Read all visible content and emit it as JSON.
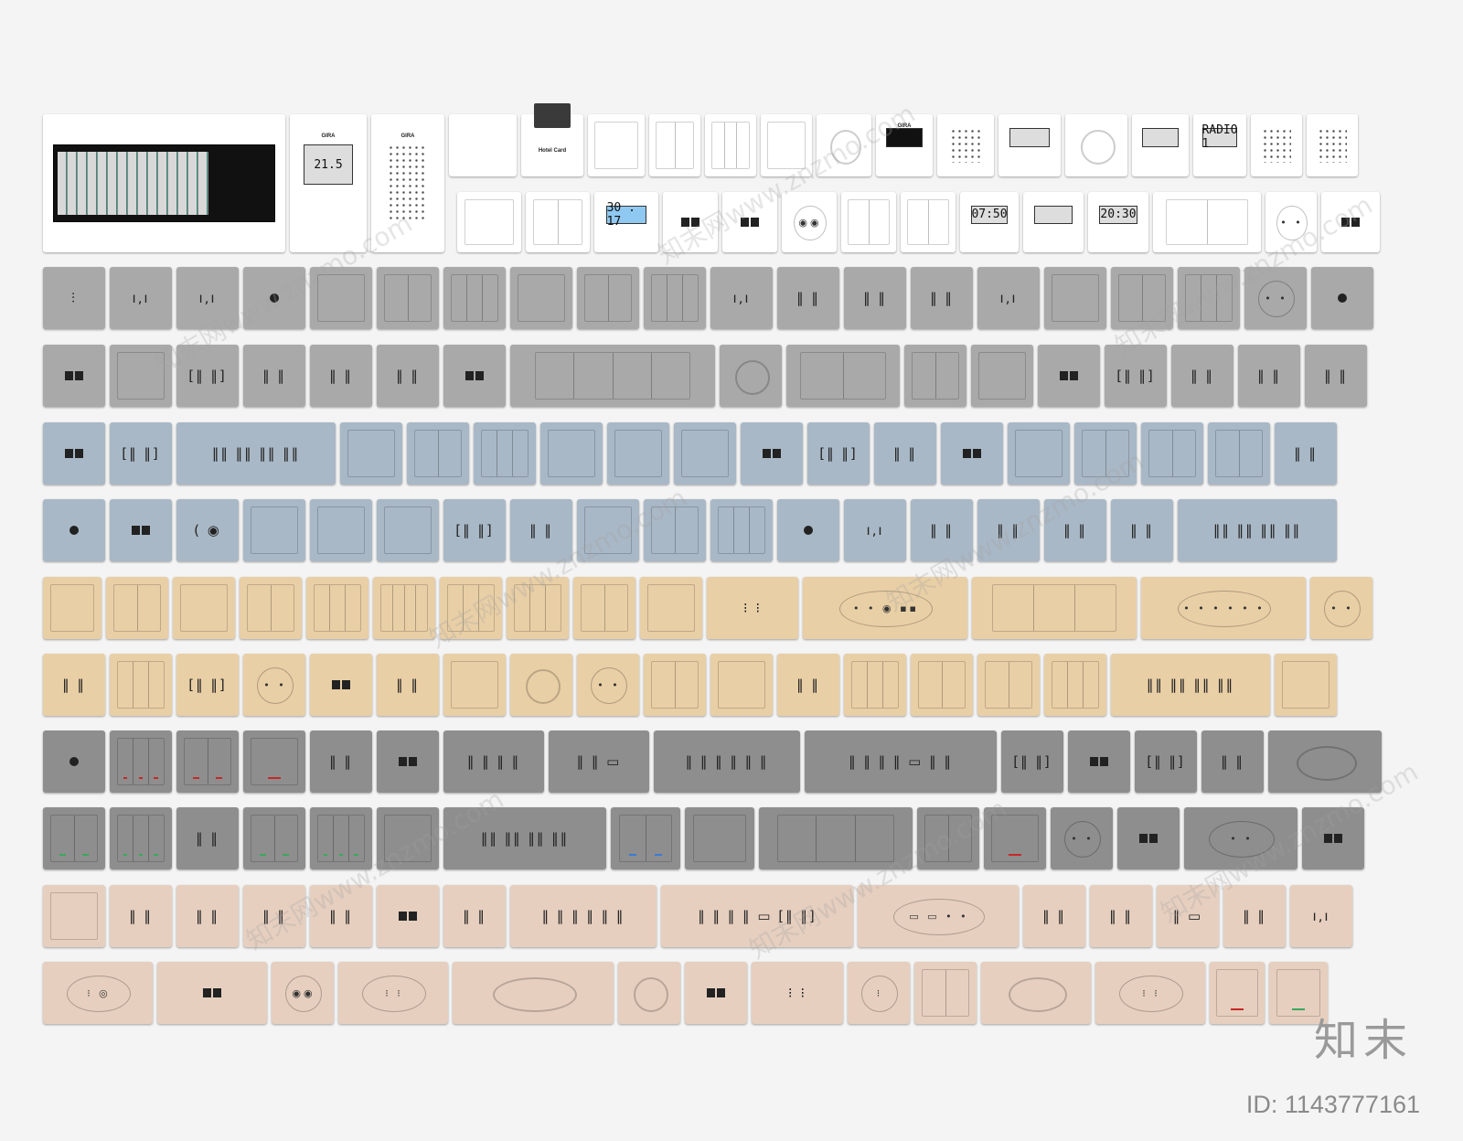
{
  "colors": {
    "white": "#ffffff",
    "gray": "#a9a9a9",
    "blue": "#a9b8c6",
    "beige": "#e9cfa6",
    "dark": "#8e8e8e",
    "pink": "#e6cfbf",
    "led_red": "#c62828",
    "led_green": "#3aa85c",
    "led_blue": "#3a7bd5"
  },
  "top_row1": [
    {
      "kind": "breaker",
      "w": 265
    },
    {
      "kind": "lcd",
      "w": 84,
      "brand": "GIRA",
      "lcd": "21.5"
    },
    {
      "kind": "grid",
      "w": 80,
      "brand": "GIRA"
    },
    {
      "kind": "sock",
      "w": 74
    },
    {
      "kind": "card",
      "w": 68,
      "card_text": "Hotel Card"
    },
    {
      "kind": "rocker",
      "n": 1,
      "w": 62
    },
    {
      "kind": "rocker",
      "n": 2,
      "w": 56
    },
    {
      "kind": "rocker",
      "n": 3,
      "w": 56
    },
    {
      "kind": "rocker",
      "n": 1,
      "w": 56
    },
    {
      "kind": "knob",
      "w": 60
    },
    {
      "kind": "lcd",
      "w": 62,
      "lcd_class": "dark",
      "brand": "GIRA"
    },
    {
      "kind": "grid",
      "w": 62
    },
    {
      "kind": "lcd",
      "w": 68
    },
    {
      "kind": "knob",
      "w": 68
    },
    {
      "kind": "lcd",
      "w": 62
    },
    {
      "kind": "lcd",
      "w": 58,
      "lcd": "RADIO 1"
    },
    {
      "kind": "grid",
      "w": 56
    },
    {
      "kind": "grid",
      "w": 56
    }
  ],
  "top_row2": [
    {
      "kind": "rocker",
      "n": 1,
      "w": 70
    },
    {
      "kind": "rocker",
      "n": 2,
      "w": 70
    },
    {
      "kind": "lcd",
      "w": 70,
      "lcd": "30 . 17",
      "lcd_class": "blue"
    },
    {
      "kind": "port",
      "w": 60
    },
    {
      "kind": "port",
      "w": 60
    },
    {
      "kind": "round",
      "w": 60,
      "sock": "◉◉"
    },
    {
      "kind": "rocker",
      "n": 2,
      "w": 60
    },
    {
      "kind": "rocker",
      "n": 2,
      "w": 60
    },
    {
      "kind": "lcd",
      "w": 64,
      "lcd": "07:50"
    },
    {
      "kind": "lcd",
      "w": 66
    },
    {
      "kind": "lcd",
      "w": 66,
      "lcd": "20:30"
    },
    {
      "kind": "rocker",
      "n": 2,
      "w": 118
    },
    {
      "kind": "round",
      "w": 56,
      "sock": "• •"
    },
    {
      "kind": "port",
      "w": 64
    }
  ],
  "grid_rows": [
    {
      "color": "gray",
      "plates": [
        {
          "kind": "sock",
          "w": 68,
          "sock": "⫶"
        },
        {
          "kind": "sock",
          "w": 68,
          "sock": "ı‚ı"
        },
        {
          "kind": "sock",
          "w": 68,
          "sock": "ı‚ı"
        },
        {
          "kind": "dot",
          "w": 68
        },
        {
          "kind": "rocker",
          "n": 1,
          "w": 68
        },
        {
          "kind": "rocker",
          "n": 2,
          "w": 68
        },
        {
          "kind": "rocker",
          "n": 3,
          "w": 68
        },
        {
          "kind": "rocker",
          "n": 1,
          "w": 68
        },
        {
          "kind": "rocker",
          "n": 2,
          "w": 68
        },
        {
          "kind": "rocker",
          "n": 3,
          "w": 68
        },
        {
          "kind": "sock",
          "w": 68,
          "sock": "ı‚ı"
        },
        {
          "kind": "sock",
          "w": 68,
          "sock": "‖ ‖"
        },
        {
          "kind": "sock",
          "w": 68,
          "sock": "‖ ‖"
        },
        {
          "kind": "sock",
          "w": 68,
          "sock": "‖ ‖"
        },
        {
          "kind": "sock",
          "w": 68,
          "sock": "ı‚ı"
        },
        {
          "kind": "rocker",
          "n": 1,
          "w": 68
        },
        {
          "kind": "rocker",
          "n": 2,
          "w": 68
        },
        {
          "kind": "rocker",
          "n": 3,
          "w": 68
        },
        {
          "kind": "round",
          "w": 68,
          "sock": "• •"
        },
        {
          "kind": "dot",
          "w": 68
        }
      ]
    },
    {
      "color": "gray",
      "plates": [
        {
          "kind": "port",
          "w": 68
        },
        {
          "kind": "rocker",
          "n": 1,
          "w": 68
        },
        {
          "kind": "sock",
          "w": 68,
          "sock": "[‖ ‖]"
        },
        {
          "kind": "sock",
          "w": 68,
          "sock": "‖ ‖"
        },
        {
          "kind": "sock",
          "w": 68,
          "sock": "‖ ‖"
        },
        {
          "kind": "sock",
          "w": 68,
          "sock": "‖ ‖"
        },
        {
          "kind": "port",
          "w": 68
        },
        {
          "kind": "rocker",
          "n": 4,
          "w": 224
        },
        {
          "kind": "knob",
          "w": 68
        },
        {
          "kind": "rocker",
          "n": 2,
          "w": 124
        },
        {
          "kind": "rocker",
          "n": 2,
          "w": 68
        },
        {
          "kind": "rocker",
          "n": 1,
          "w": 68
        },
        {
          "kind": "port",
          "w": 68
        },
        {
          "kind": "sock",
          "w": 68,
          "sock": "[‖ ‖]"
        },
        {
          "kind": "sock",
          "w": 68,
          "sock": "‖ ‖"
        },
        {
          "kind": "sock",
          "w": 68,
          "sock": "‖ ‖"
        },
        {
          "kind": "sock",
          "w": 68,
          "sock": "‖ ‖"
        }
      ]
    },
    {
      "color": "blue",
      "plates": [
        {
          "kind": "port",
          "w": 68
        },
        {
          "kind": "sock",
          "w": 68,
          "sock": "[‖ ‖]"
        },
        {
          "kind": "sock",
          "w": 174,
          "sock": "‖‖ ‖‖ ‖‖ ‖‖"
        },
        {
          "kind": "rocker",
          "n": 1,
          "w": 68
        },
        {
          "kind": "rocker",
          "n": 2,
          "w": 68
        },
        {
          "kind": "rocker",
          "n": 3,
          "w": 68
        },
        {
          "kind": "rocker",
          "n": 1,
          "w": 68
        },
        {
          "kind": "rocker",
          "n": 1,
          "w": 68
        },
        {
          "kind": "rocker",
          "n": 1,
          "w": 68
        },
        {
          "kind": "port",
          "w": 68
        },
        {
          "kind": "sock",
          "w": 68,
          "sock": "[‖ ‖]"
        },
        {
          "kind": "sock",
          "w": 68,
          "sock": "‖ ‖"
        },
        {
          "kind": "port",
          "w": 68
        },
        {
          "kind": "rocker",
          "n": 1,
          "w": 68
        },
        {
          "kind": "rocker",
          "n": 2,
          "w": 68
        },
        {
          "kind": "rocker",
          "n": 2,
          "w": 68
        },
        {
          "kind": "rocker",
          "n": 2,
          "w": 68
        },
        {
          "kind": "sock",
          "w": 68,
          "sock": "‖ ‖"
        }
      ]
    },
    {
      "color": "blue",
      "plates": [
        {
          "kind": "dot",
          "w": 68
        },
        {
          "kind": "port",
          "w": 68
        },
        {
          "kind": "sock",
          "w": 68,
          "sock": "( ◉"
        },
        {
          "kind": "rocker",
          "n": 1,
          "w": 68
        },
        {
          "kind": "rocker",
          "n": 1,
          "w": 68
        },
        {
          "kind": "rocker",
          "n": 1,
          "w": 68
        },
        {
          "kind": "sock",
          "w": 68,
          "sock": "[‖ ‖]"
        },
        {
          "kind": "sock",
          "w": 68,
          "sock": "‖ ‖"
        },
        {
          "kind": "rocker",
          "n": 1,
          "w": 68
        },
        {
          "kind": "rocker",
          "n": 2,
          "w": 68
        },
        {
          "kind": "rocker",
          "n": 3,
          "w": 68
        },
        {
          "kind": "dot",
          "w": 68
        },
        {
          "kind": "sock",
          "w": 68,
          "sock": "ı‚ı"
        },
        {
          "kind": "sock",
          "w": 68,
          "sock": "‖ ‖"
        },
        {
          "kind": "sock",
          "w": 68,
          "sock": "‖ ‖"
        },
        {
          "kind": "sock",
          "w": 68,
          "sock": "‖ ‖"
        },
        {
          "kind": "sock",
          "w": 68,
          "sock": "‖ ‖"
        },
        {
          "kind": "sock",
          "w": 174,
          "sock": "‖‖ ‖‖ ‖‖ ‖‖"
        }
      ]
    },
    {
      "color": "beige",
      "plates": [
        {
          "kind": "rocker",
          "n": 1,
          "w": 64
        },
        {
          "kind": "rocker",
          "n": 2,
          "w": 68
        },
        {
          "kind": "rocker",
          "n": 1,
          "w": 68
        },
        {
          "kind": "rocker",
          "n": 2,
          "w": 68
        },
        {
          "kind": "rocker",
          "n": 3,
          "w": 68
        },
        {
          "kind": "rocker",
          "n": 4,
          "w": 68
        },
        {
          "kind": "rocker",
          "n": 3,
          "w": 68
        },
        {
          "kind": "rocker",
          "n": 3,
          "w": 68
        },
        {
          "kind": "rocker",
          "n": 2,
          "w": 68
        },
        {
          "kind": "rocker",
          "n": 1,
          "w": 68
        },
        {
          "kind": "sock",
          "w": 100,
          "sock": "⁝ ⁝"
        },
        {
          "kind": "round",
          "w": 180,
          "sock": "• • ◉ ▪▪"
        },
        {
          "kind": "rocker",
          "n": 3,
          "w": 180
        },
        {
          "kind": "round",
          "w": 180,
          "sock": "• • • • • •"
        },
        {
          "kind": "round",
          "w": 68,
          "sock": "• •"
        }
      ]
    },
    {
      "color": "beige",
      "plates": [
        {
          "kind": "sock",
          "w": 68,
          "sock": "‖ ‖"
        },
        {
          "kind": "rocker",
          "n": 3,
          "w": 68
        },
        {
          "kind": "sock",
          "w": 68,
          "sock": "[‖ ‖]"
        },
        {
          "kind": "round",
          "w": 68,
          "sock": "• •"
        },
        {
          "kind": "port",
          "w": 68
        },
        {
          "kind": "sock",
          "w": 68,
          "sock": "‖ ‖"
        },
        {
          "kind": "rocker",
          "n": 1,
          "w": 68
        },
        {
          "kind": "knob",
          "w": 68
        },
        {
          "kind": "round",
          "w": 68,
          "sock": "• •"
        },
        {
          "kind": "rocker",
          "n": 2,
          "w": 68
        },
        {
          "kind": "rocker",
          "n": 1,
          "w": 68
        },
        {
          "kind": "sock",
          "w": 68,
          "sock": "‖ ‖"
        },
        {
          "kind": "rocker",
          "n": 3,
          "w": 68
        },
        {
          "kind": "rocker",
          "n": 2,
          "w": 68
        },
        {
          "kind": "rocker",
          "n": 2,
          "w": 68
        },
        {
          "kind": "rocker",
          "n": 3,
          "w": 68
        },
        {
          "kind": "sock",
          "w": 174,
          "sock": "‖‖ ‖‖ ‖‖ ‖‖"
        },
        {
          "kind": "rocker",
          "n": 1,
          "w": 68
        }
      ]
    },
    {
      "color": "dark",
      "plates": [
        {
          "kind": "dot",
          "w": 68
        },
        {
          "kind": "rocker",
          "n": 3,
          "w": 68,
          "led": "led_red"
        },
        {
          "kind": "rocker",
          "n": 2,
          "w": 68,
          "led": "led_red"
        },
        {
          "kind": "rocker",
          "n": 1,
          "w": 68,
          "led": "led_red"
        },
        {
          "kind": "sock",
          "w": 68,
          "sock": "‖ ‖"
        },
        {
          "kind": "port",
          "w": 68
        },
        {
          "kind": "sock",
          "w": 110,
          "sock": "‖ ‖  ‖ ‖"
        },
        {
          "kind": "sock",
          "w": 110,
          "sock": "‖ ‖ ▭"
        },
        {
          "kind": "sock",
          "w": 160,
          "sock": "‖ ‖ ‖ ‖ ‖ ‖"
        },
        {
          "kind": "sock",
          "w": 210,
          "sock": "‖ ‖ ‖ ‖ ▭ ‖ ‖"
        },
        {
          "kind": "sock",
          "w": 68,
          "sock": "[‖ ‖]"
        },
        {
          "kind": "port",
          "w": 68
        },
        {
          "kind": "sock",
          "w": 68,
          "sock": "[‖ ‖]"
        },
        {
          "kind": "sock",
          "w": 68,
          "sock": "‖ ‖"
        },
        {
          "kind": "knob",
          "w": 124
        }
      ]
    },
    {
      "color": "dark",
      "plates": [
        {
          "kind": "rocker",
          "n": 2,
          "w": 68,
          "led": "led_green"
        },
        {
          "kind": "rocker",
          "n": 3,
          "w": 68,
          "led": "led_green"
        },
        {
          "kind": "sock",
          "w": 68,
          "sock": "‖ ‖"
        },
        {
          "kind": "rocker",
          "n": 2,
          "w": 68,
          "led": "led_green"
        },
        {
          "kind": "rocker",
          "n": 3,
          "w": 68,
          "led": "led_green"
        },
        {
          "kind": "rocker",
          "n": 1,
          "w": 68
        },
        {
          "kind": "sock",
          "w": 178,
          "sock": "‖‖ ‖‖ ‖‖ ‖‖"
        },
        {
          "kind": "rocker",
          "n": 2,
          "w": 76,
          "led": "led_blue"
        },
        {
          "kind": "rocker",
          "n": 1,
          "w": 76
        },
        {
          "kind": "rocker",
          "n": 3,
          "w": 168
        },
        {
          "kind": "rocker",
          "n": 2,
          "w": 68
        },
        {
          "kind": "rocker",
          "n": 1,
          "w": 68,
          "led": "led_red"
        },
        {
          "kind": "round",
          "w": 68,
          "sock": "• •"
        },
        {
          "kind": "port",
          "w": 68
        },
        {
          "kind": "round",
          "w": 124,
          "sock": "• •"
        },
        {
          "kind": "port",
          "w": 68
        }
      ]
    },
    {
      "color": "pink",
      "plates": [
        {
          "kind": "rocker",
          "n": 1,
          "w": 68
        },
        {
          "kind": "sock",
          "w": 68,
          "sock": "‖ ‖"
        },
        {
          "kind": "sock",
          "w": 68,
          "sock": "‖ ‖"
        },
        {
          "kind": "sock",
          "w": 68,
          "sock": "‖ ‖"
        },
        {
          "kind": "sock",
          "w": 68,
          "sock": "‖ ‖"
        },
        {
          "kind": "port",
          "w": 68
        },
        {
          "kind": "sock",
          "w": 68,
          "sock": "‖ ‖"
        },
        {
          "kind": "sock",
          "w": 160,
          "sock": "‖ ‖ ‖ ‖ ‖ ‖"
        },
        {
          "kind": "sock",
          "w": 210,
          "sock": "‖ ‖ ‖ ‖ ▭ [‖ ‖]"
        },
        {
          "kind": "round",
          "w": 176,
          "sock": "▭ ▭ • •"
        },
        {
          "kind": "sock",
          "w": 68,
          "sock": "‖ ‖"
        },
        {
          "kind": "sock",
          "w": 68,
          "sock": "‖ ‖"
        },
        {
          "kind": "sock",
          "w": 68,
          "sock": "‖ ▭"
        },
        {
          "kind": "sock",
          "w": 68,
          "sock": "‖ ‖"
        },
        {
          "kind": "sock",
          "w": 68,
          "sock": "ı‚ı"
        }
      ]
    },
    {
      "color": "pink",
      "plates": [
        {
          "kind": "round",
          "w": 120,
          "sock": "⁝  ◎"
        },
        {
          "kind": "port",
          "w": 120
        },
        {
          "kind": "round",
          "w": 68,
          "sock": "◉◉"
        },
        {
          "kind": "round",
          "w": 120,
          "sock": "⁝  ⁝"
        },
        {
          "kind": "knob",
          "w": 176
        },
        {
          "kind": "knob",
          "w": 68
        },
        {
          "kind": "port",
          "w": 68
        },
        {
          "kind": "sock",
          "w": 100,
          "sock": "⁝ ⁝"
        },
        {
          "kind": "round",
          "w": 68,
          "sock": "⁝"
        },
        {
          "kind": "rocker",
          "n": 2,
          "w": 68
        },
        {
          "kind": "knob",
          "w": 120
        },
        {
          "kind": "round",
          "w": 120,
          "sock": "⁝  ⁝"
        },
        {
          "kind": "rocker",
          "n": 1,
          "w": 60,
          "led": "led_red"
        },
        {
          "kind": "rocker",
          "n": 1,
          "w": 64,
          "led": "led_green"
        }
      ]
    }
  ],
  "watermark": {
    "text": "知末网www.znzmo.com",
    "logo": "知末",
    "id": "ID: 1143777161"
  }
}
